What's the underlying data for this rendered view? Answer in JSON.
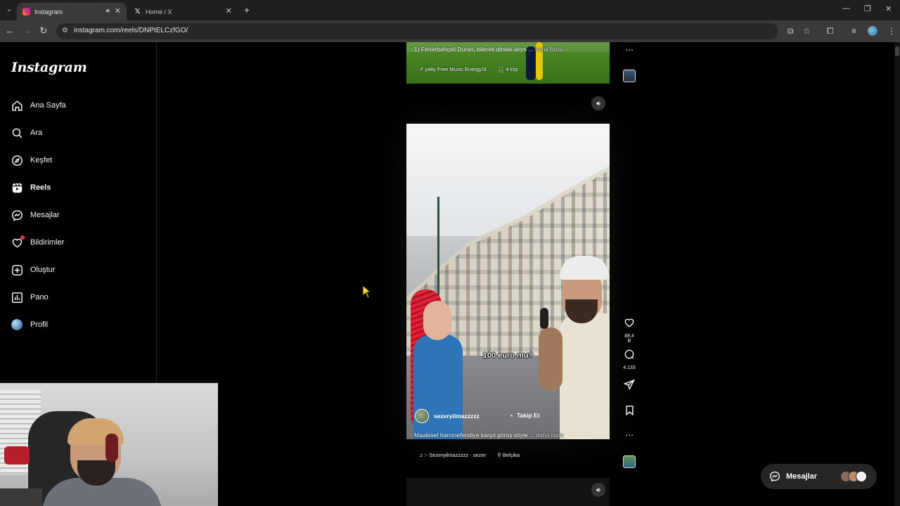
{
  "browser": {
    "tabs": [
      {
        "title": "Instagram",
        "active": true
      },
      {
        "title": "Home / X",
        "active": false
      }
    ],
    "url": "instagram.com/reels/DNPtELCzfGO/"
  },
  "sidebar": {
    "logo": "Instagram",
    "items": [
      {
        "label": "Ana Sayfa",
        "icon": "home-icon"
      },
      {
        "label": "Ara",
        "icon": "search-icon"
      },
      {
        "label": "Keşfet",
        "icon": "compass-icon"
      },
      {
        "label": "Reels",
        "icon": "reels-icon"
      },
      {
        "label": "Mesajlar",
        "icon": "messenger-icon"
      },
      {
        "label": "Bildirimler",
        "icon": "heart-icon"
      },
      {
        "label": "Oluştur",
        "icon": "plus-square-icon"
      },
      {
        "label": "Pano",
        "icon": "dashboard-icon"
      },
      {
        "label": "Profil",
        "icon": "profile-avatar"
      }
    ]
  },
  "reel_top": {
    "caption": "1) Fenerbahçeli Duran, bilerek dirsek atıyo ...",
    "more": "daha fazla",
    "audio": "yalty Free Music EnergySt",
    "people": "4 kişi"
  },
  "main_reel": {
    "subtitle": "100 euro mu?",
    "author": "sezeryilmazzzzz",
    "follow": "Takip Et",
    "caption": "Maalesef hanımefendiye karşıt görüş söyle ...",
    "more": "daha fazla",
    "audio": "♫ :- Sezeryilmazzzzz · sezer",
    "location": "Belçika",
    "likes": "88,4 B",
    "comments": "4.133"
  },
  "messages": {
    "label": "Mesajlar"
  },
  "colors": {
    "background": "#000000",
    "notification": "#ff3040",
    "chrome_toolbar": "#3a3a3a"
  }
}
